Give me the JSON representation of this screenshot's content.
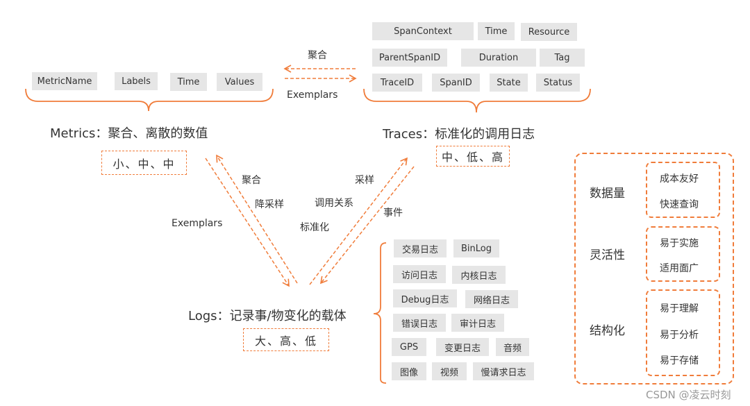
{
  "metrics": {
    "fields": [
      "MetricName",
      "Labels",
      "Time",
      "Values"
    ],
    "title": "Metrics：聚合、离散的数值",
    "rating": "小、中、中"
  },
  "traces": {
    "fields_row1": [
      "SpanContext",
      "Time",
      "Resource"
    ],
    "fields_row2": [
      "ParentSpanID",
      "Duration",
      "Tag"
    ],
    "fields_row3": [
      "TraceID",
      "SpanID",
      "State",
      "Status"
    ],
    "title": "Traces：标准化的调用日志",
    "rating": "中、低、高"
  },
  "logs": {
    "title": "Logs：记录事/物变化的载体",
    "rating": "大、高、低",
    "types": [
      [
        "交易日志",
        "BinLog"
      ],
      [
        "访问日志",
        "内核日志"
      ],
      [
        "Debug日志",
        "网络日志"
      ],
      [
        "错误日志",
        "审计日志"
      ],
      [
        "GPS",
        "变更日志",
        "音频"
      ],
      [
        "图像",
        "视频",
        "慢请求日志"
      ]
    ]
  },
  "links": {
    "metrics_traces_top": "聚合",
    "metrics_traces_bottom": "Exemplars",
    "metrics_logs_up": "聚合",
    "metrics_logs_mid": "降采样",
    "metrics_logs_left": "Exemplars",
    "traces_logs_up": "采样",
    "traces_logs_mid": "调用关系",
    "traces_logs_low": "标准化",
    "traces_logs_right": "事件"
  },
  "legend": {
    "groups": [
      {
        "name": "数据量",
        "items": [
          "成本友好",
          "快速查询"
        ]
      },
      {
        "name": "灵活性",
        "items": [
          "易于实施",
          "适用面广"
        ]
      },
      {
        "name": "结构化",
        "items": [
          "易于理解",
          "易于分析",
          "易于存储"
        ]
      }
    ]
  },
  "watermark": "CSDN @凌云时刻",
  "accent_color": "#f07c3a"
}
